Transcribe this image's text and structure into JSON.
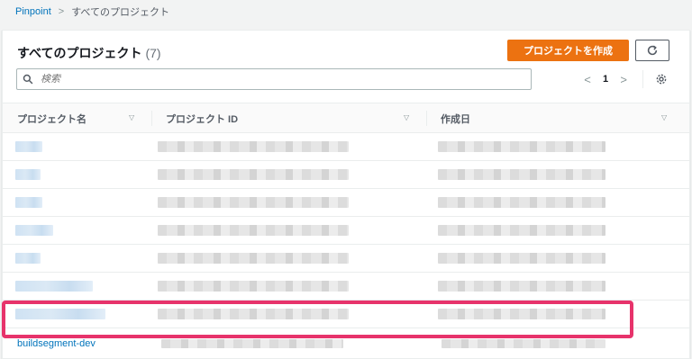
{
  "breadcrumb": {
    "root": "Pinpoint",
    "separator": ">",
    "current": "すべてのプロジェクト"
  },
  "panel": {
    "title": "すべてのプロジェクト",
    "count": "(7)",
    "create_button": "プロジェクトを作成",
    "refresh_icon": "refresh-icon"
  },
  "search": {
    "placeholder": "検索",
    "value": ""
  },
  "pagination": {
    "prev": "<",
    "page": "1",
    "next": ">",
    "settings_icon": "gear-icon"
  },
  "table": {
    "columns": [
      {
        "label": "プロジェクト名"
      },
      {
        "label": "プロジェクト ID"
      },
      {
        "label": "作成日"
      }
    ],
    "rows": [
      {
        "name": "",
        "id": "",
        "created": ""
      },
      {
        "name": "",
        "id": "",
        "created": ""
      },
      {
        "name": "",
        "id": "",
        "created": ""
      },
      {
        "name": "",
        "id": "",
        "created": ""
      },
      {
        "name": "",
        "id": "",
        "created": ""
      },
      {
        "name": "",
        "id": "",
        "created": ""
      },
      {
        "name": "buildsegment-dev",
        "id": "",
        "created": ""
      }
    ]
  },
  "colors": {
    "accent": "#ec7211",
    "link": "#0073bb",
    "highlight": "#e7336b"
  }
}
